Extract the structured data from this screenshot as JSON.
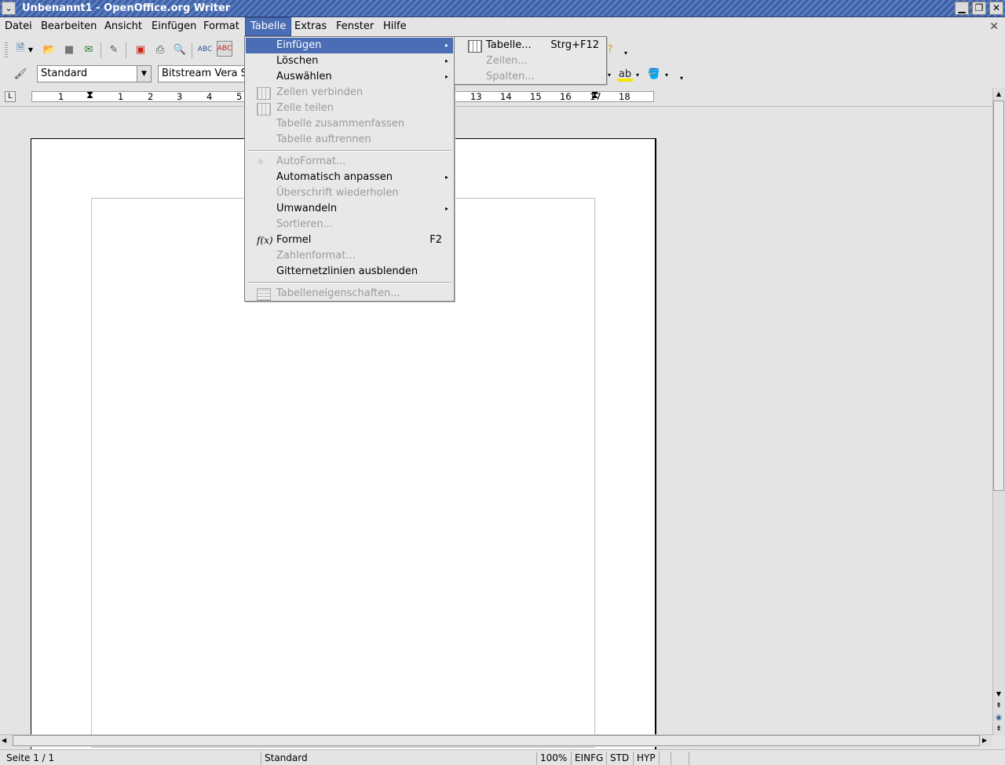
{
  "window": {
    "title": "Unbenannt1 - OpenOffice.org Writer"
  },
  "menubar": {
    "items": [
      {
        "label": "Datei"
      },
      {
        "label": "Bearbeiten"
      },
      {
        "label": "Ansicht"
      },
      {
        "label": "Einfügen"
      },
      {
        "label": "Format"
      },
      {
        "label": "Tabelle"
      },
      {
        "label": "Extras"
      },
      {
        "label": "Fenster"
      },
      {
        "label": "Hilfe"
      }
    ]
  },
  "formatting": {
    "style_value": "Standard",
    "font_value": "Bitstream Vera S"
  },
  "ruler": {
    "labels": [
      "1",
      "1",
      "2",
      "3",
      "4",
      "5",
      "13",
      "14",
      "15",
      "16",
      "17",
      "18"
    ]
  },
  "table_menu": {
    "items": [
      {
        "label": "Einfügen",
        "enabled": true,
        "submenu": true
      },
      {
        "label": "Löschen",
        "enabled": true,
        "submenu": true
      },
      {
        "label": "Auswählen",
        "enabled": true,
        "submenu": true
      },
      {
        "label": "Zellen verbinden",
        "enabled": false
      },
      {
        "label": "Zelle teilen",
        "enabled": false
      },
      {
        "label": "Tabelle zusammenfassen",
        "enabled": false
      },
      {
        "label": "Tabelle auftrennen",
        "enabled": false
      },
      {
        "label": "AutoFormat...",
        "enabled": false
      },
      {
        "label": "Automatisch anpassen",
        "enabled": true,
        "submenu": true
      },
      {
        "label": "Überschrift wiederholen",
        "enabled": false
      },
      {
        "label": "Umwandeln",
        "enabled": true,
        "submenu": true
      },
      {
        "label": "Sortieren...",
        "enabled": false
      },
      {
        "label": "Formel",
        "enabled": true,
        "shortcut": "F2"
      },
      {
        "label": "Zahlenformat...",
        "enabled": false
      },
      {
        "label": "Gitternetzlinien ausblenden",
        "enabled": true
      },
      {
        "label": "Tabelleneigenschaften...",
        "enabled": false
      }
    ]
  },
  "insert_submenu": {
    "items": [
      {
        "label": "Tabelle...",
        "shortcut": "Strg+F12",
        "enabled": true
      },
      {
        "label": "Zeilen...",
        "enabled": false
      },
      {
        "label": "Spalten...",
        "enabled": false
      }
    ]
  },
  "statusbar": {
    "page": "Seite 1 / 1",
    "style": "Standard",
    "zoom": "100%",
    "insert_mode": "EINFG",
    "selection_mode": "STD",
    "hyperlink_mode": "HYP"
  }
}
